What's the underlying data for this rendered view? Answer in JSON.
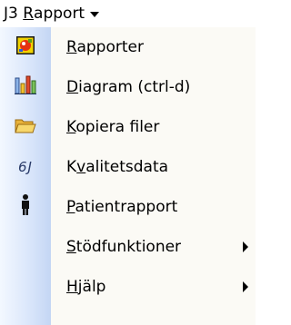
{
  "menubar": {
    "title_prefix": "J3 ",
    "title_u": "R",
    "title_rest": "apport"
  },
  "menu": {
    "items": [
      {
        "icon": "rapporter-icon",
        "pre": "",
        "u": "R",
        "post": "apporter",
        "submenu": false
      },
      {
        "icon": "chart-icon",
        "pre": "",
        "u": "D",
        "post": "iagram (ctrl-d)",
        "submenu": false
      },
      {
        "icon": "folder-icon",
        "pre": "",
        "u": "K",
        "post": "opiera filer",
        "submenu": false
      },
      {
        "icon": "quality-data-icon",
        "pre": "K",
        "u": "v",
        "post": "alitetsdata",
        "submenu": false,
        "icon_text": "6J"
      },
      {
        "icon": "person-icon",
        "pre": "",
        "u": "P",
        "post": "atientrapport",
        "submenu": false
      },
      {
        "icon": "",
        "pre": "",
        "u": "S",
        "post": "tödfunktioner",
        "submenu": true
      },
      {
        "icon": "",
        "pre": "",
        "u": "H",
        "post": "jälp",
        "submenu": true
      }
    ]
  }
}
